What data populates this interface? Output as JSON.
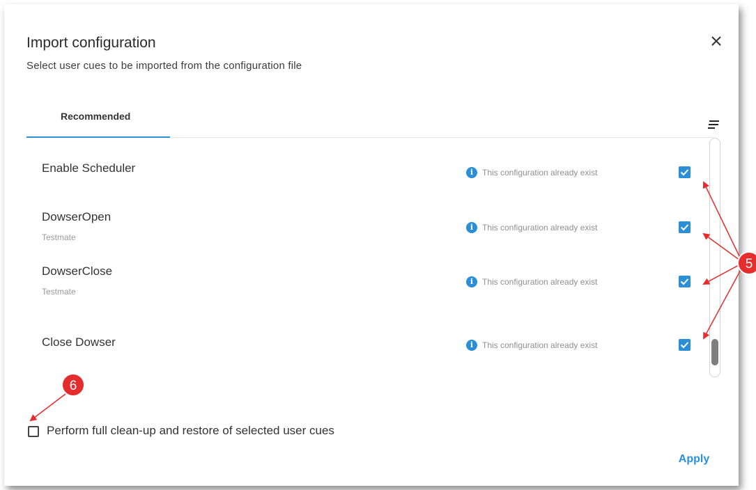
{
  "dialog": {
    "title": "Import configuration",
    "subtitle": "Select user cues to be imported from the configuration file",
    "close_icon": "close-icon",
    "filter_icon": "filter-icon"
  },
  "tabs": [
    {
      "label": "Recommended",
      "active": true
    }
  ],
  "items": [
    {
      "name": "Enable Scheduler",
      "sub": "",
      "status": "This configuration already exist",
      "checked": true
    },
    {
      "name": "DowserOpen",
      "sub": "Testmate",
      "status": "This configuration already exist",
      "checked": true
    },
    {
      "name": "DowserClose",
      "sub": "Testmate",
      "status": "This configuration already exist",
      "checked": true
    },
    {
      "name": "Close Dowser",
      "sub": "",
      "status": "This configuration already exist",
      "checked": true
    }
  ],
  "cleanup": {
    "label": "Perform full clean-up and restore of selected user cues",
    "checked": false
  },
  "apply_label": "Apply",
  "annotations": [
    {
      "label": "5",
      "color": "#e52d2d"
    },
    {
      "label": "6",
      "color": "#e52d2d"
    }
  ],
  "colors": {
    "accent": "#2b8fd6",
    "annotation": "#e52d2d"
  }
}
